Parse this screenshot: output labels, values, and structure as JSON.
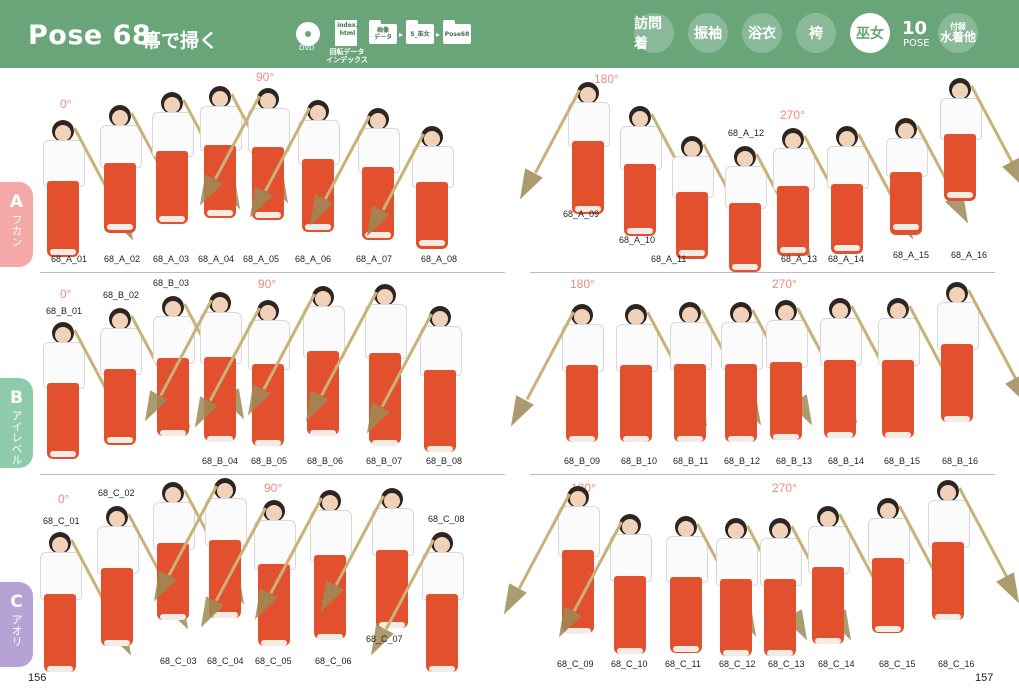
{
  "header": {
    "title": "Pose 68",
    "subtitle": "箒で掃く",
    "dvd_label": "DVD",
    "index_file": "index.\nhtml",
    "index_caption": "回転データ\nインデックス",
    "folders": [
      "画像\nデータ",
      "5_巫女",
      "Pose68"
    ],
    "nav": [
      "訪問着",
      "振袖",
      "浴衣",
      "袴",
      "巫女"
    ],
    "pose_count": "10",
    "pose_label": "POSE",
    "appendix_small": "付録",
    "appendix_main": "水着他"
  },
  "tabs": [
    {
      "letter": "A",
      "text": "フカン"
    },
    {
      "letter": "B",
      "text": "アイレベル"
    },
    {
      "letter": "C",
      "text": "アオリ"
    }
  ],
  "angles": {
    "a0": "0°",
    "a90": "90°",
    "a180": "180°",
    "a270": "270°"
  },
  "labels_a": [
    "68_A_01",
    "68_A_02",
    "68_A_03",
    "68_A_04",
    "68_A_05",
    "68_A_06",
    "68_A_07",
    "68_A_08",
    "68_A_09",
    "68_A_10",
    "68_A_11",
    "68_A_12",
    "68_A_13",
    "68_A_14",
    "68_A_15",
    "68_A_16"
  ],
  "labels_b": [
    "68_B_01",
    "68_B_02",
    "68_B_03",
    "68_B_04",
    "68_B_05",
    "68_B_06",
    "68_B_07",
    "68_B_08",
    "68_B_09",
    "68_B_10",
    "68_B_11",
    "68_B_12",
    "68_B_13",
    "68_B_14",
    "68_B_15",
    "68_B_16"
  ],
  "labels_c": [
    "68_C_01",
    "68_C_02",
    "68_C_03",
    "68_C_04",
    "68_C_05",
    "68_C_06",
    "68_C_07",
    "68_C_08",
    "68_C_09",
    "68_C_10",
    "68_C_11",
    "68_C_12",
    "68_C_13",
    "68_C_14",
    "68_C_15",
    "68_C_16"
  ],
  "pages": {
    "left": "156",
    "right": "157"
  },
  "colors": {
    "header": "#6aa57a",
    "tab_a": "#f5a8a8",
    "tab_b": "#8dcbab",
    "tab_c": "#b7a2d6",
    "angle": "#f08a7e",
    "hakama": "#e2502e"
  }
}
